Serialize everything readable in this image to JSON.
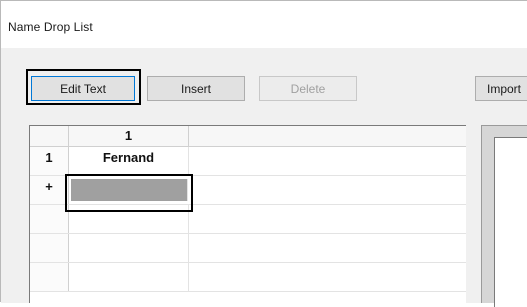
{
  "window": {
    "title": "Name Drop List"
  },
  "toolbar": {
    "edit_text_label": "Edit Text",
    "insert_label": "Insert",
    "delete_label": "Delete",
    "import_label": "Import"
  },
  "grid": {
    "column_headers": [
      "1"
    ],
    "rows": [
      {
        "header": "1",
        "cells": [
          "Fernand"
        ]
      },
      {
        "header": "+",
        "cells": [
          ""
        ]
      }
    ]
  }
}
